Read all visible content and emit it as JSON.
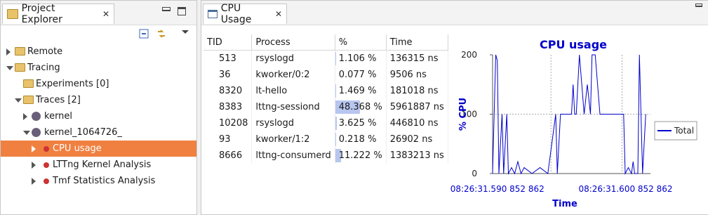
{
  "explorer": {
    "tab_label": "Project Explorer",
    "tree": [
      {
        "label": "Remote",
        "state": "closed",
        "level": 0,
        "icon": "folder"
      },
      {
        "label": "Tracing",
        "state": "open",
        "level": 0,
        "icon": "folder"
      },
      {
        "label": "Experiments [0]",
        "state": "none",
        "level": 1,
        "icon": "folder"
      },
      {
        "label": "Traces [2]",
        "state": "open",
        "level": 1,
        "icon": "folder"
      },
      {
        "label": "kernel",
        "state": "closed",
        "level": 2,
        "icon": "trace"
      },
      {
        "label": "kernel_1064726_",
        "state": "open",
        "level": 2,
        "icon": "trace"
      },
      {
        "label": "CPU usage",
        "state": "closed",
        "level": 3,
        "icon": "analysis",
        "selected": true
      },
      {
        "label": "LTTng Kernel Analysis",
        "state": "closed",
        "level": 3,
        "icon": "analysis"
      },
      {
        "label": "Tmf Statistics Analysis",
        "state": "closed",
        "level": 3,
        "icon": "analysis"
      }
    ]
  },
  "usage": {
    "tab_label": "CPU Usage",
    "columns": [
      "TID",
      "Process",
      "%",
      "Time"
    ],
    "rows": [
      {
        "tid": "513",
        "process": "rsyslogd",
        "pct": "1.106 %",
        "pct_value": 1.106,
        "time": "136315 ns"
      },
      {
        "tid": "36",
        "process": "kworker/0:2",
        "pct": "0.077 %",
        "pct_value": 0.077,
        "time": "9506 ns"
      },
      {
        "tid": "8320",
        "process": "lt-hello",
        "pct": "1.469 %",
        "pct_value": 1.469,
        "time": "181018 ns"
      },
      {
        "tid": "8383",
        "process": "lttng-sessiond",
        "pct": "48.368 %",
        "pct_value": 48.368,
        "time": "5961887 ns"
      },
      {
        "tid": "10208",
        "process": "rsyslogd",
        "pct": "3.625 %",
        "pct_value": 3.625,
        "time": "446810 ns"
      },
      {
        "tid": "93",
        "process": "kworker/1:2",
        "pct": "0.218 %",
        "pct_value": 0.218,
        "time": "26902 ns"
      },
      {
        "tid": "8666",
        "process": "lttng-consumerd",
        "pct": "11.222 %",
        "pct_value": 11.222,
        "time": "1383213 ns"
      }
    ]
  },
  "chart_data": {
    "type": "line",
    "title": "CPU usage",
    "xlabel": "Time",
    "ylabel": "% CPU",
    "ylim": [
      0,
      200
    ],
    "yticks": [
      "0",
      "100",
      "200"
    ],
    "xticks": [
      "08:26:31.590 852 862",
      "08:26:31.600 852 862"
    ],
    "grid": true,
    "legend_position": "right",
    "series": [
      {
        "name": "Total",
        "x": [
          0,
          2,
          3,
          4,
          6,
          7,
          9,
          10,
          12,
          14,
          16,
          18,
          20,
          25,
          30,
          35,
          40,
          41,
          43,
          45,
          50,
          51,
          52,
          53,
          55,
          58,
          60,
          62,
          63,
          65,
          68,
          70,
          72,
          73,
          74,
          75,
          78,
          80,
          83,
          84,
          86,
          88,
          89,
          90,
          92,
          93,
          95,
          97
        ],
        "y": [
          0,
          200,
          190,
          0,
          100,
          0,
          100,
          0,
          10,
          0,
          20,
          0,
          10,
          0,
          10,
          0,
          100,
          0,
          100,
          100,
          100,
          150,
          100,
          100,
          200,
          100,
          150,
          100,
          200,
          200,
          100,
          100,
          100,
          100,
          100,
          100,
          100,
          100,
          100,
          0,
          10,
          0,
          20,
          0,
          0,
          200,
          0,
          100
        ]
      }
    ],
    "colors": {
      "line": "#0000cc",
      "title": "#0000cc"
    }
  }
}
